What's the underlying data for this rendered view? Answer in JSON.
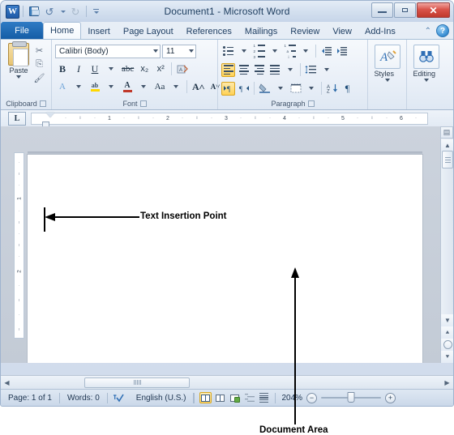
{
  "window": {
    "title": "Document1  -  Microsoft Word",
    "controls": {
      "minimize": "minimize-icon",
      "maximize": "maximize-icon",
      "close": "✕"
    }
  },
  "quick_access": {
    "logo": "W",
    "items": [
      {
        "name": "save-icon",
        "label": "Save"
      },
      {
        "name": "undo-icon",
        "label": "Undo",
        "glyph": "↺"
      },
      {
        "name": "redo-icon",
        "label": "Redo",
        "glyph": "↻"
      },
      {
        "name": "customize-qat-icon",
        "label": "Customize Quick Access Toolbar"
      }
    ]
  },
  "tabs": {
    "file": "File",
    "items": [
      {
        "label": "Home",
        "active": true
      },
      {
        "label": "Insert",
        "active": false
      },
      {
        "label": "Page Layout",
        "active": false
      },
      {
        "label": "References",
        "active": false
      },
      {
        "label": "Mailings",
        "active": false
      },
      {
        "label": "Review",
        "active": false
      },
      {
        "label": "View",
        "active": false
      },
      {
        "label": "Add-Ins",
        "active": false
      }
    ],
    "minimize_ribbon": "⌃",
    "help": "?"
  },
  "ribbon": {
    "clipboard": {
      "label": "Clipboard",
      "paste": "Paste",
      "cut": "✂",
      "copy": "⎘",
      "format_painter": "🖌"
    },
    "font": {
      "label": "Font",
      "font_name": "Calibri (Body)",
      "font_size": "11",
      "bold": "B",
      "italic": "I",
      "underline": "U",
      "strikethrough": "abc",
      "subscript": "x₂",
      "superscript": "x²",
      "clear_formatting": "clear-formatting-icon",
      "text_effects": "A",
      "highlight": "ab",
      "font_color": "A",
      "change_case": "Aa",
      "grow_font": "A",
      "shrink_font": "A"
    },
    "paragraph": {
      "label": "Paragraph",
      "bullets": "bullets-icon",
      "numbering": "numbering-icon",
      "multilevel": "multilevel-list-icon",
      "decrease_indent": "decrease-indent-icon",
      "increase_indent": "increase-indent-icon",
      "align_left": "align-left-icon",
      "align_center": "align-center-icon",
      "align_right": "align-right-icon",
      "justify": "justify-icon",
      "line_spacing": "line-spacing-icon",
      "ltr": "left-to-right-icon",
      "rtl": "right-to-left-icon",
      "shading": "shading-icon",
      "borders": "borders-icon",
      "sort": "sort-icon",
      "show_marks": "¶"
    },
    "styles": {
      "label": "Styles"
    },
    "editing": {
      "label": "Editing"
    }
  },
  "ruler": {
    "tab_stop": "L",
    "units": [
      "1",
      "2",
      "3",
      "4",
      "5",
      "6"
    ]
  },
  "vertical_ruler": {
    "units": [
      "1",
      "2"
    ]
  },
  "scrollbars": {
    "vertical": {
      "up": "▲",
      "down": "▼",
      "previous_page": "▲",
      "browse_object": "browse-object-icon",
      "next_page": "▼",
      "ruler_toggle": "ruler-toggle-icon"
    },
    "horizontal": {
      "left": "◀",
      "right": "▶"
    }
  },
  "status_bar": {
    "page": "Page: 1 of 1",
    "words": "Words: 0",
    "proofing_icon": "spell-check-icon",
    "language": "English (U.S.)",
    "views": [
      {
        "name": "print-layout",
        "selected": true
      },
      {
        "name": "full-screen-reading",
        "selected": false
      },
      {
        "name": "web-layout",
        "selected": false
      },
      {
        "name": "outline",
        "selected": false
      },
      {
        "name": "draft",
        "selected": false
      }
    ],
    "zoom_level": "204%",
    "zoom_out": "−",
    "zoom_in": "+"
  },
  "annotations": {
    "insertion_point": "Text Insertion Point",
    "document_area": "Document Area"
  },
  "colors": {
    "accent": "#1f5aa8",
    "close_button": "#c0392b",
    "selected_highlight": "#ffd256",
    "canvas": "#c9d1dc"
  }
}
